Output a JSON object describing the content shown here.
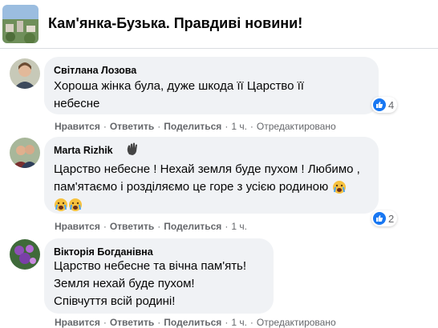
{
  "group": {
    "title": "Кам'янка-Бузька. Правдиві новини!"
  },
  "comments": [
    {
      "author": "Світлана Лозова",
      "lines": [
        "Хороша жінка була, дуже шкода її Царство її",
        "небесне"
      ],
      "reaction_count": "4",
      "actions": {
        "like": "Нравится",
        "reply": "Ответить",
        "share": "Поделиться",
        "time": "1 ч.",
        "edited": "Отредактировано"
      }
    },
    {
      "author": "Marta Rizhik",
      "lines": [
        "Царство небесне ! Нехай земля буде пухом ! Любимо ,",
        "пам'ятаємо і розділяємо це горе з усією родиною"
      ],
      "reaction_count": "2",
      "actions": {
        "like": "Нравится",
        "reply": "Ответить",
        "share": "Поделиться",
        "time": "1 ч."
      }
    },
    {
      "author": "Вікторія Богданівна",
      "lines": [
        "Царство небесне та вічна пам'ять!",
        "Земля нехай буде пухом!",
        "Співчуття всій родині!"
      ],
      "actions": {
        "like": "Нравится",
        "reply": "Ответить",
        "share": "Поделиться",
        "time": "1 ч.",
        "edited": "Отредактировано"
      }
    }
  ],
  "icons": {
    "like": "like-icon",
    "crying": "crying-face-icon",
    "wave": "waving-hand-icon"
  },
  "colors": {
    "like_blue": "#1877f2",
    "bubble": "#f0f2f5",
    "meta_text": "#65676b"
  }
}
